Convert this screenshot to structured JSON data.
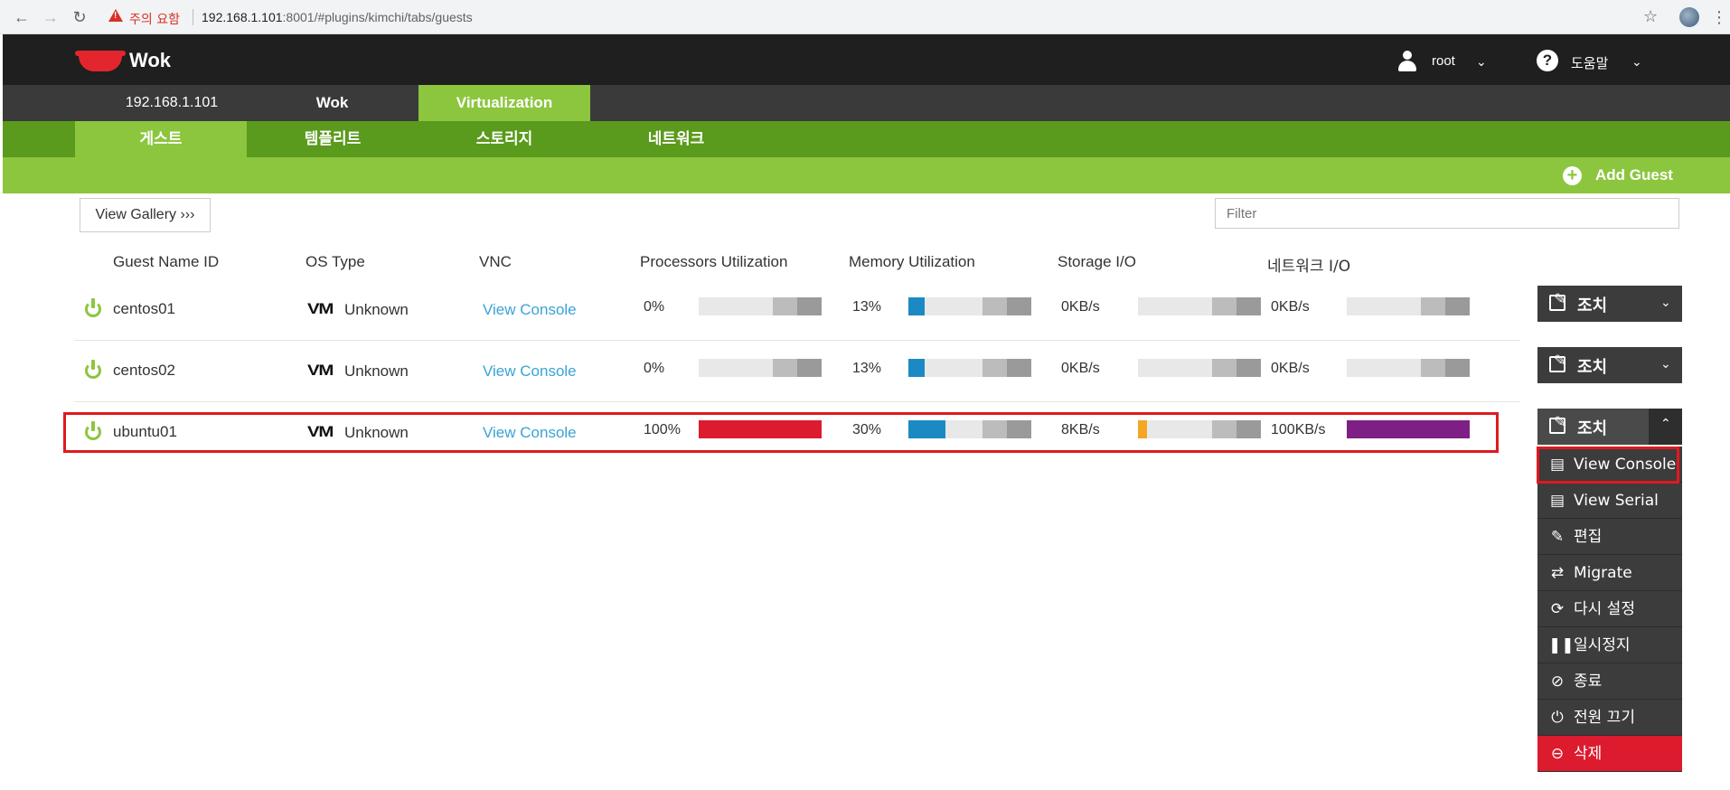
{
  "browser": {
    "warning": "주의 요함",
    "url_host": "192.168.1.101",
    "url_rest": ":8001/#plugins/kimchi/tabs/guests"
  },
  "header": {
    "brand": "Wok",
    "user": "root",
    "help": "도움말"
  },
  "host_tabs": [
    "192.168.1.101",
    "Wok",
    "Virtualization"
  ],
  "sub_tabs": [
    "게스트",
    "템플리트",
    "스토리지",
    "네트워크"
  ],
  "actions": {
    "add_guest": "Add Guest",
    "view_gallery": "View Gallery ›››",
    "filter_placeholder": "Filter"
  },
  "columns": [
    "Guest Name ID",
    "OS Type",
    "VNC",
    "Processors Utilization",
    "Memory Utilization",
    "Storage I/O",
    "네트워크 I/O"
  ],
  "guests": [
    {
      "name": "centos01",
      "os_logo": "VM",
      "os": "Unknown",
      "vnc": "View Console",
      "cpu": "0%",
      "cpu_fill": 0,
      "mem": "13%",
      "mem_fill": 0.13,
      "storage": "0KB/s",
      "storage_fill": 0,
      "net": "0KB/s",
      "net_fill": 0,
      "action": "조치"
    },
    {
      "name": "centos02",
      "os_logo": "VM",
      "os": "Unknown",
      "vnc": "View Console",
      "cpu": "0%",
      "cpu_fill": 0,
      "mem": "13%",
      "mem_fill": 0.13,
      "storage": "0KB/s",
      "storage_fill": 0,
      "net": "0KB/s",
      "net_fill": 0,
      "action": "조치"
    },
    {
      "name": "ubuntu01",
      "os_logo": "VM",
      "os": "Unknown",
      "vnc": "View Console",
      "cpu": "100%",
      "cpu_fill": 1.0,
      "mem": "30%",
      "mem_fill": 0.3,
      "storage": "8KB/s",
      "storage_fill": 0.07,
      "net": "100KB/s",
      "net_fill": 1.0,
      "action": "조치"
    }
  ],
  "menu": [
    {
      "icon": "▤",
      "label": "View Console"
    },
    {
      "icon": "▤",
      "label": "View Serial"
    },
    {
      "icon": "✎",
      "label": "편집"
    },
    {
      "icon": "⇄",
      "label": "Migrate"
    },
    {
      "icon": "⟳",
      "label": "다시 설정"
    },
    {
      "icon": "❚❚",
      "label": "일시정지"
    },
    {
      "icon": "⊘",
      "label": "종료"
    },
    {
      "icon": "⏻",
      "label": "전원 끄기"
    },
    {
      "icon": "⊖",
      "label": "삭제"
    }
  ],
  "colors": {
    "cpu": "#dc1b2e",
    "mem": "#1b8ac4",
    "storage": "#f5a623",
    "net": "#7e1f86",
    "accent_green": "#8cc63f",
    "dark_green": "#5a9a1c"
  }
}
